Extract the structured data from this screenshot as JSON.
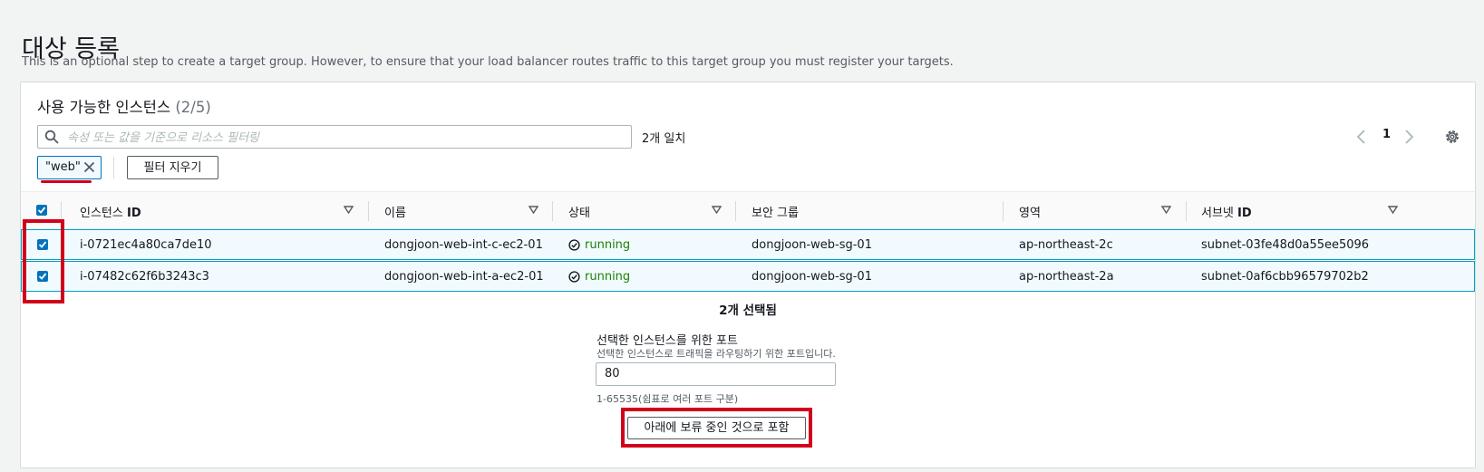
{
  "page": {
    "title": "대상 등록",
    "description": "This is an optional step to create a target group. However, to ensure that your load balancer routes traffic to this target group you must register your targets."
  },
  "instances_panel": {
    "title": "사용 가능한 인스턴스",
    "count": "(2/5)",
    "search": {
      "placeholder": "속성 또는 값을 기준으로 리소스 필터링",
      "value": "",
      "icon": "search-icon"
    },
    "match_count": "2개 일치",
    "pagination": {
      "current_page": "1"
    },
    "filter_token": "\"web\"",
    "clear_filter_label": "필터 지우기",
    "columns": [
      {
        "prefix": "인스턴스",
        "suffix": "ID"
      },
      {
        "prefix": "이름",
        "suffix": ""
      },
      {
        "prefix": "상태",
        "suffix": ""
      },
      {
        "prefix": "보안 그룹",
        "suffix": ""
      },
      {
        "prefix": "영역",
        "suffix": ""
      },
      {
        "prefix": "서브넷",
        "suffix": "ID"
      }
    ],
    "rows": [
      {
        "selected": true,
        "instance_id": "i-0721ec4a80ca7de10",
        "name": "dongjoon-web-int-c-ec2-01",
        "status": "running",
        "security_group": "dongjoon-web-sg-01",
        "zone": "ap-northeast-2c",
        "subnet_id": "subnet-03fe48d0a55ee5096"
      },
      {
        "selected": true,
        "instance_id": "i-07482c62f6b3243c3",
        "name": "dongjoon-web-int-a-ec2-01",
        "status": "running",
        "security_group": "dongjoon-web-sg-01",
        "zone": "ap-northeast-2a",
        "subnet_id": "subnet-0af6cbb96579702b2"
      }
    ],
    "selected_summary": "2개 선택됨",
    "port": {
      "label": "선택한 인스턴스를 위한 포트",
      "description": "선택한 인스턴스로 트래픽을 라우팅하기 위한 포트입니다.",
      "value": "80",
      "constraint": "1-65535(쉼표로 여러 포트 구분)"
    },
    "include_button_label": "아래에 보류 중인 것으로 포함"
  },
  "colors": {
    "accent": "#0073bb",
    "running": "#1d8102",
    "highlight": "#d0021b",
    "selected_row_bg": "#f1faff"
  }
}
